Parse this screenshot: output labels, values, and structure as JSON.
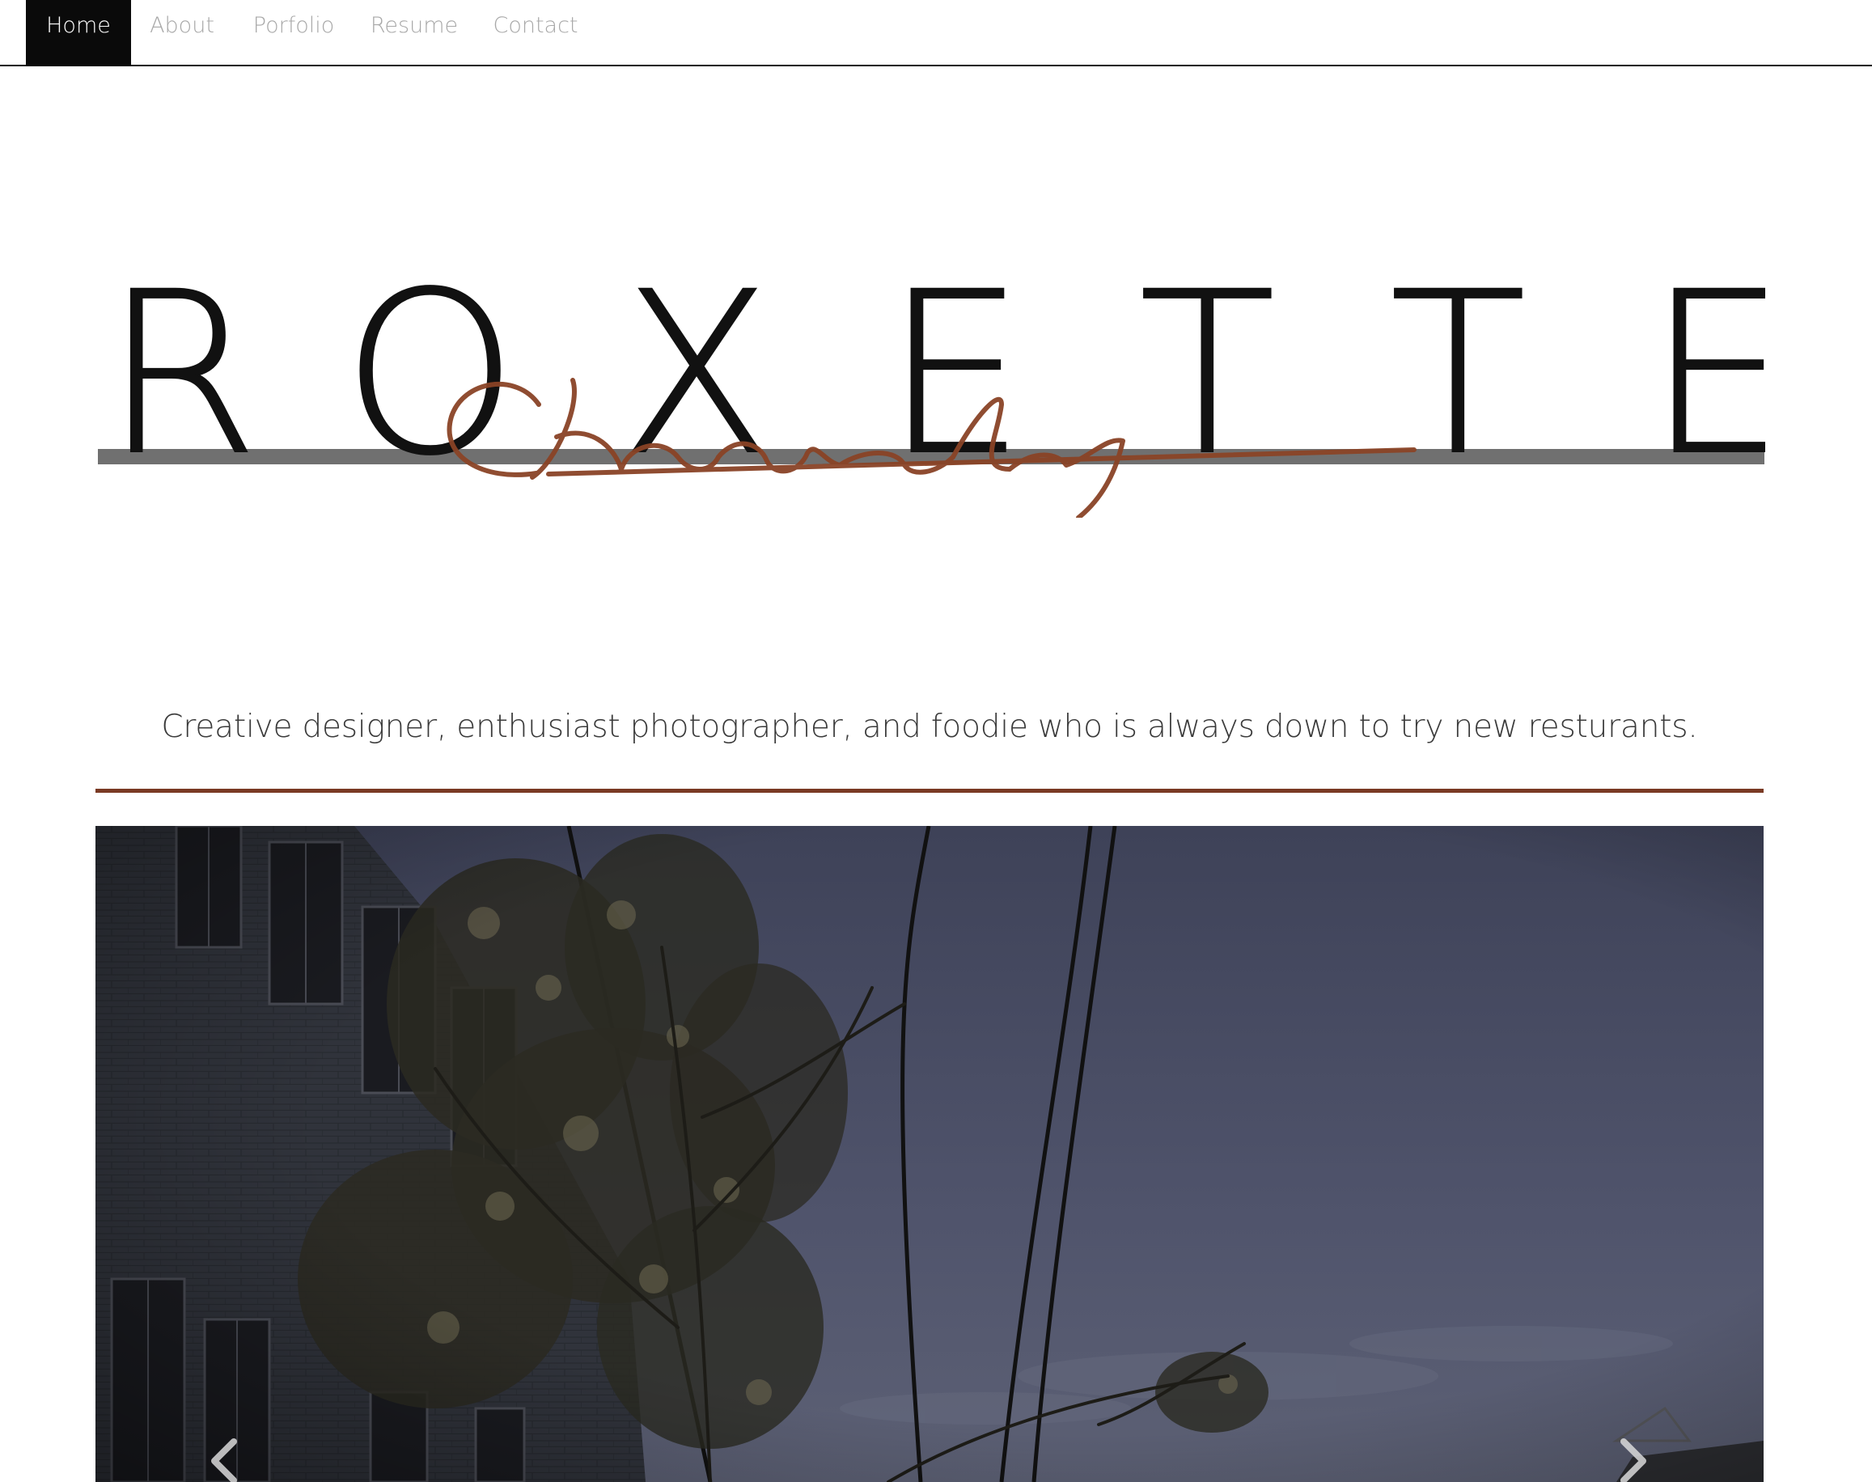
{
  "nav": {
    "items": [
      {
        "label": "Home",
        "active": true
      },
      {
        "label": "About",
        "active": false
      },
      {
        "label": "Porfolio",
        "active": false
      },
      {
        "label": "Resume",
        "active": false
      },
      {
        "label": "Contact",
        "active": false
      }
    ]
  },
  "hero": {
    "logo_text": "ROXETTE",
    "logo_script": "Chaucly"
  },
  "tagline": "Creative designer, enthusiast photographer, and foodie who is always down to try new resturants.",
  "colors": {
    "accent": "#7a3a24",
    "nav_active_bg": "#0a0a0a",
    "nav_text": "#a8a8a8",
    "sky": "#4b4f66"
  },
  "slideshow": {
    "prev_icon": "chevron-left-icon",
    "next_icon": "chevron-right-icon"
  }
}
